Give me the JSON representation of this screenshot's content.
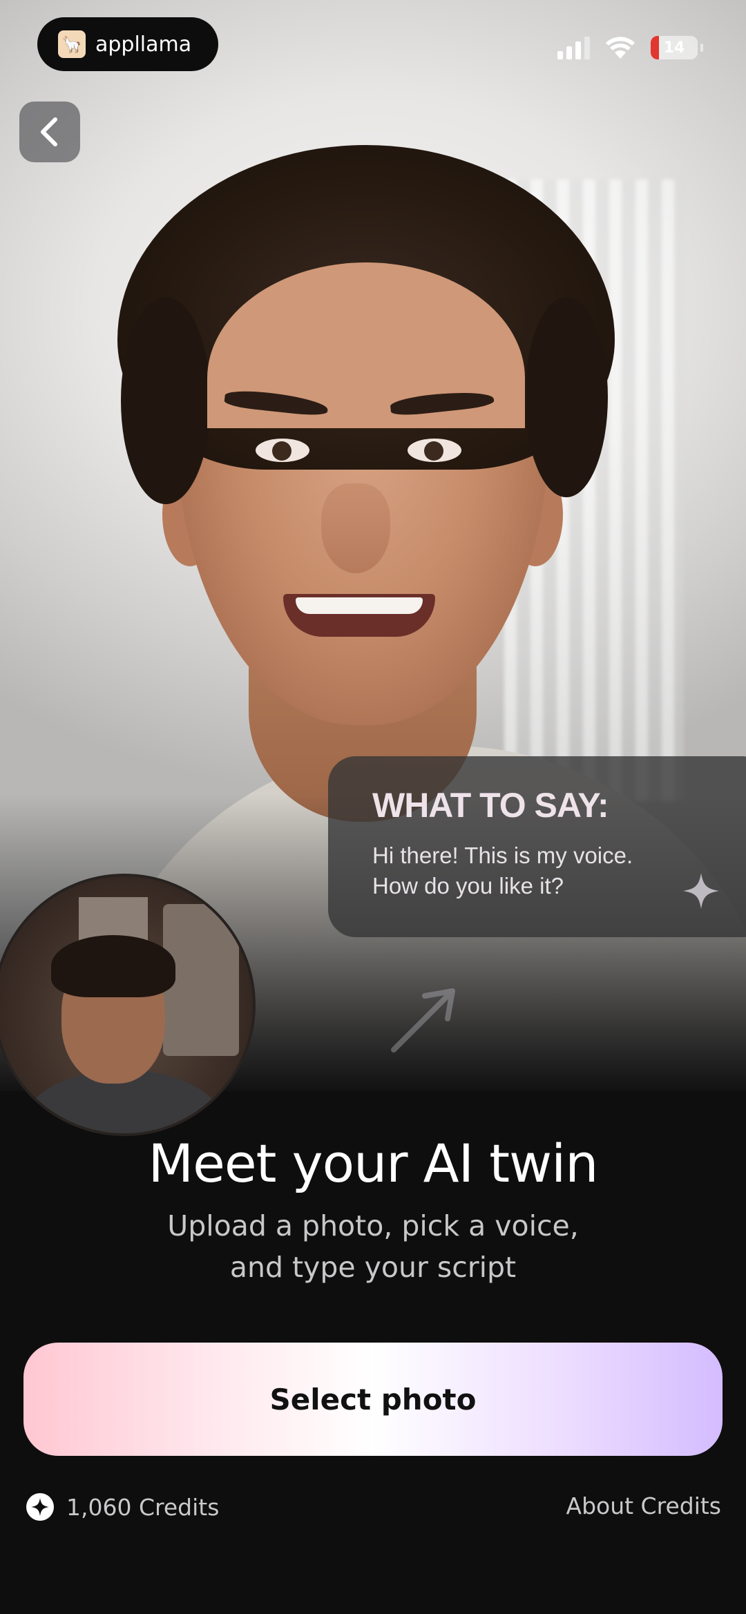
{
  "status_bar": {
    "app_name": "appllama",
    "battery_level": "14",
    "battery_color": "#e2372f",
    "icons": [
      "app-logo-icon",
      "cellular-signal-icon",
      "wifi-icon",
      "battery-icon"
    ]
  },
  "nav": {
    "back_icon": "chevron-left-icon"
  },
  "prompt_card": {
    "title": "WHAT TO SAY:",
    "line1": "Hi there! This is my voice.",
    "line2": "How do you like it?",
    "icon": "sparkle-icon"
  },
  "hero": {
    "subject": "smiling man portrait",
    "inset": "small circular source photo"
  },
  "content": {
    "title": "Meet your AI twin",
    "subtitle_line1": "Upload a photo, pick a voice,",
    "subtitle_line2": "and type your script"
  },
  "actions": {
    "select_photo_label": "Select photo",
    "button_gradient": [
      "#ffc7d2",
      "#ffffff",
      "#d4bcff"
    ]
  },
  "footer": {
    "credits_label": "1,060 Credits",
    "credits_icon": "credits-coin-icon",
    "about_credits_label": "About Credits"
  }
}
